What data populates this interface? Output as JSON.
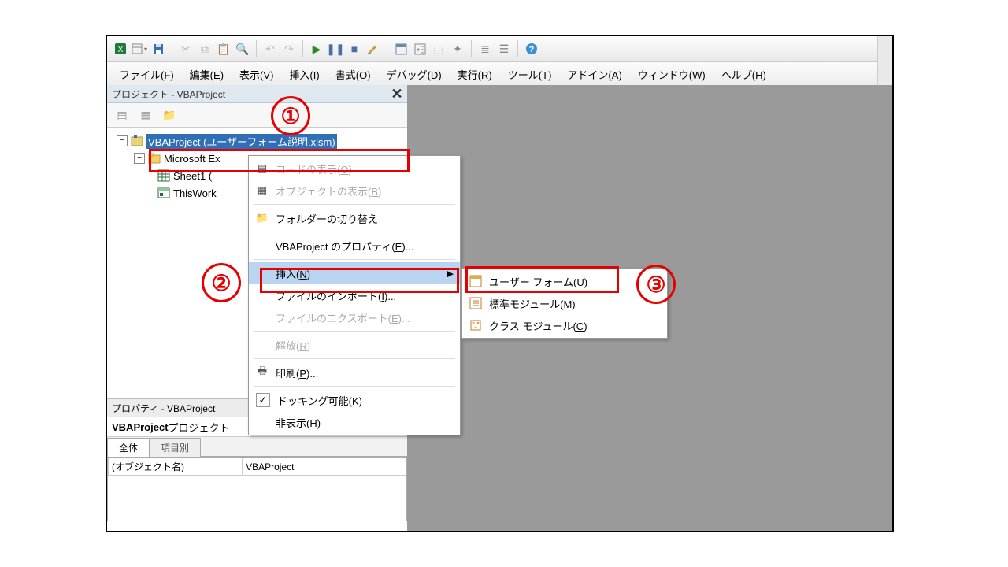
{
  "window": {
    "project_panel_title": "プロジェクト - VBAProject",
    "properties_panel_title": "プロパティ - VBAProject",
    "close_x": "✕"
  },
  "menubar": {
    "items": [
      {
        "label": "ファイル",
        "k": "F"
      },
      {
        "label": "編集",
        "k": "E"
      },
      {
        "label": "表示",
        "k": "V"
      },
      {
        "label": "挿入",
        "k": "I"
      },
      {
        "label": "書式",
        "k": "O"
      },
      {
        "label": "デバッグ",
        "k": "D"
      },
      {
        "label": "実行",
        "k": "R"
      },
      {
        "label": "ツール",
        "k": "T"
      },
      {
        "label": "アドイン",
        "k": "A"
      },
      {
        "label": "ウィンドウ",
        "k": "W"
      },
      {
        "label": "ヘルプ",
        "k": "H"
      }
    ]
  },
  "tree": {
    "root": "VBAProject (ユーザーフォーム説明.xlsm)",
    "folder": "Microsoft Ex",
    "sheet": "Sheet1 (",
    "workbook": "ThisWork"
  },
  "properties": {
    "header_bold": "VBAProject",
    "header_rest": " プロジェクト",
    "tabs": {
      "all": "全体",
      "cat": "項目別"
    },
    "row": {
      "name": "(オブジェクト名)",
      "val": "VBAProject"
    }
  },
  "ctx_main": {
    "items": [
      {
        "id": "code",
        "label": "コードの表示",
        "k": "O",
        "disabled": true,
        "icon": ""
      },
      {
        "id": "obj",
        "label": "オブジェクトの表示",
        "k": "B",
        "disabled": true,
        "icon": ""
      },
      {
        "id": "folder",
        "label": "フォルダーの切り替え",
        "k": "",
        "icon": "folder"
      },
      {
        "id": "props",
        "label": "VBAProject のプロパティ",
        "k": "E",
        "suffix": "...",
        "icon": ""
      },
      {
        "id": "insert",
        "label": "挿入",
        "k": "N",
        "sub": true,
        "hl": true,
        "icon": ""
      },
      {
        "id": "import",
        "label": "ファイルのインポート",
        "k": "I",
        "suffix": "...",
        "icon": ""
      },
      {
        "id": "export",
        "label": "ファイルのエクスポート",
        "k": "E",
        "suffix": "...",
        "disabled": true,
        "icon": ""
      },
      {
        "id": "release",
        "label": "解放",
        "k": "R",
        "disabled": true,
        "icon": ""
      },
      {
        "id": "print",
        "label": "印刷",
        "k": "P",
        "suffix": "...",
        "icon": "print"
      },
      {
        "id": "dock",
        "label": "ドッキング可能",
        "k": "K",
        "check": true,
        "icon": ""
      },
      {
        "id": "hide",
        "label": "非表示",
        "k": "H",
        "icon": ""
      }
    ]
  },
  "ctx_sub": {
    "items": [
      {
        "id": "userform",
        "label": "ユーザー フォーム",
        "k": "U",
        "icon": "form",
        "hl": false
      },
      {
        "id": "module",
        "label": "標準モジュール",
        "k": "M",
        "icon": "mod"
      },
      {
        "id": "class",
        "label": "クラス モジュール",
        "k": "C",
        "icon": "cls"
      }
    ]
  },
  "annotations": {
    "n1": "①",
    "n2": "②",
    "n3": "③"
  }
}
